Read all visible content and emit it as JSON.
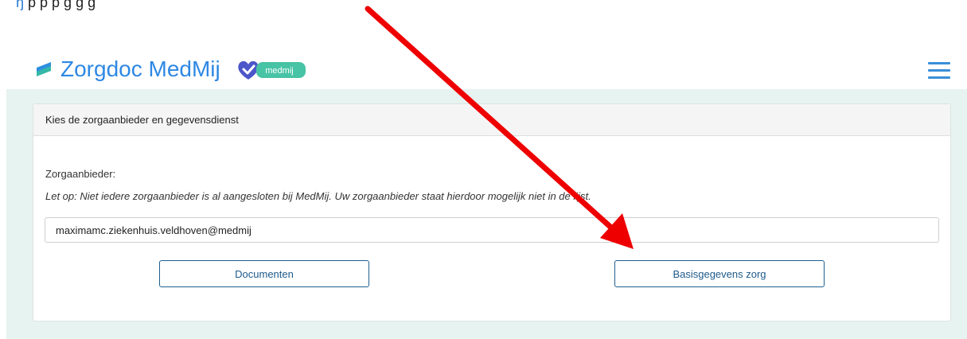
{
  "top_cut_text": {
    "first": "ŋ",
    "rest": "   p     p   p    g g     g"
  },
  "header": {
    "title": "Zorgdoc MedMij",
    "badge_text": "medmij"
  },
  "card": {
    "header": "Kies de zorgaanbieder en gegevensdienst",
    "provider_label": "Zorgaanbieder:",
    "note": "Let op: Niet iedere zorgaanbieder is al aangesloten bij MedMij. Uw zorgaanbieder staat hierdoor mogelijk niet in de lijst.",
    "provider_value": "maximamc.ziekenhuis.veldhoven@medmij",
    "buttons": {
      "documents": "Documenten",
      "basis": "Basisgegevens zorg"
    }
  },
  "colors": {
    "brand_blue": "#2e88e4",
    "page_bg": "#e6f3f1",
    "button_border": "#1f5f8f",
    "arrow": "#ee0000"
  },
  "icons": {
    "logo": "zorgdoc-logo-icon",
    "badge": "medmij-heart-badge-icon",
    "menu": "hamburger-menu-icon",
    "annotation": "red-arrow-annotation"
  }
}
